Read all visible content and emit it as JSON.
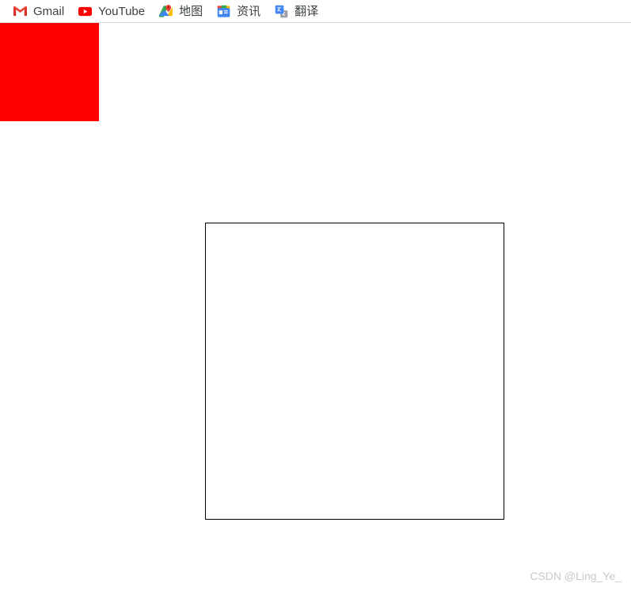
{
  "bookmarks_bar": {
    "items": [
      {
        "label": "Gmail",
        "icon": "gmail-icon",
        "name": "bookmark-gmail"
      },
      {
        "label": "YouTube",
        "icon": "youtube-icon",
        "name": "bookmark-youtube"
      },
      {
        "label": "地图",
        "icon": "maps-icon",
        "name": "bookmark-maps"
      },
      {
        "label": "资讯",
        "icon": "news-icon",
        "name": "bookmark-news"
      },
      {
        "label": "翻译",
        "icon": "translate-icon",
        "name": "bookmark-translate"
      }
    ]
  },
  "red_block": {
    "color": "#ff0000"
  },
  "outlined_box": {
    "border_color": "#000000",
    "fill_color": "#ffffff"
  },
  "watermark": {
    "text": "CSDN @Ling_Ye_",
    "color": "#c9c9c9"
  },
  "colors": {
    "separator": "#dcdcdc",
    "text": "#3c4043",
    "page_background": "#ffffff"
  }
}
